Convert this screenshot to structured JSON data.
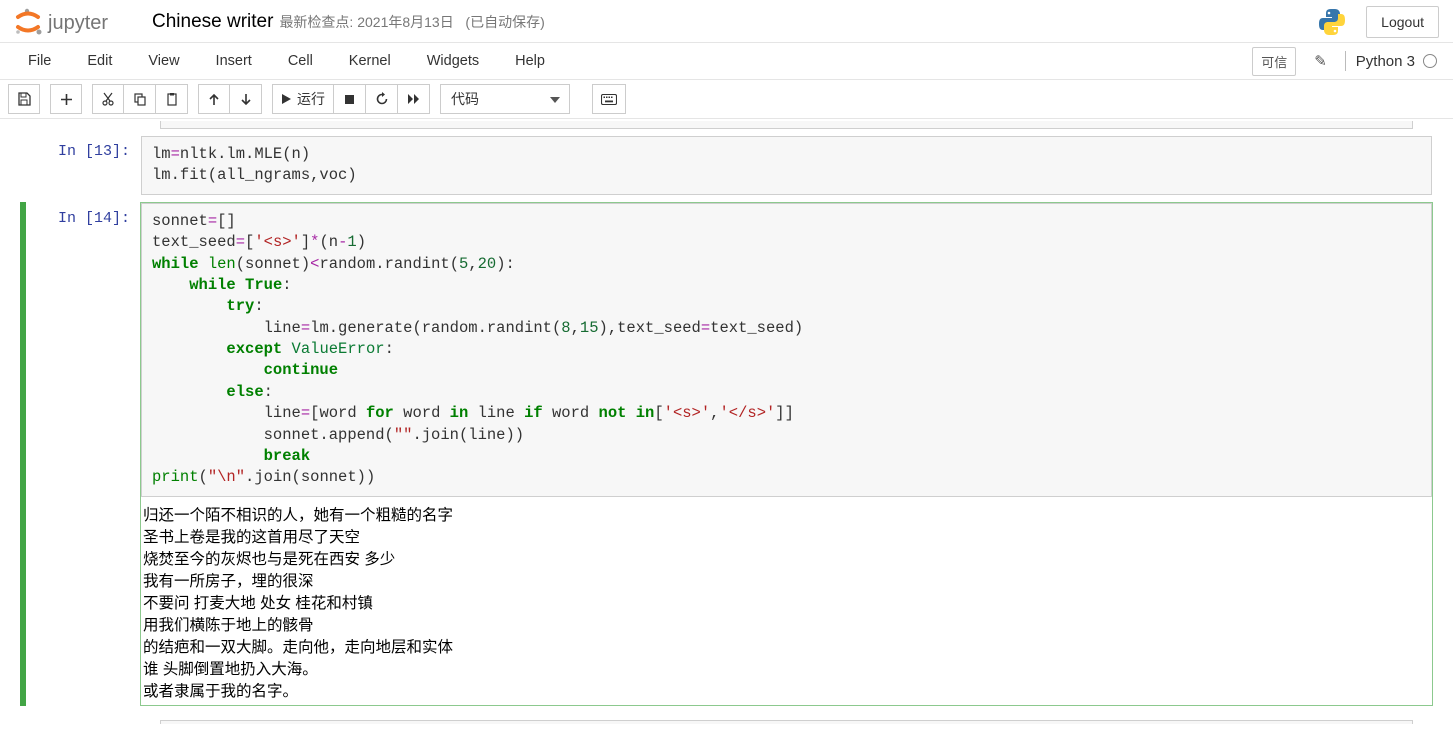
{
  "header": {
    "logo_text": "jupyter",
    "notebook_title": "Chinese writer",
    "checkpoint_label": "最新检查点: 2021年8月13日",
    "autosave_label": "(已自动保存)",
    "logout": "Logout"
  },
  "menu": {
    "file": "File",
    "edit": "Edit",
    "view": "View",
    "insert": "Insert",
    "cell": "Cell",
    "kernel": "Kernel",
    "widgets": "Widgets",
    "help": "Help",
    "trusted": "可信",
    "kernel_name": "Python 3"
  },
  "toolbar": {
    "run_label": "运行",
    "cell_type": "代码"
  },
  "cells": {
    "cell13": {
      "prompt": "In [13]:",
      "line1_a": "lm",
      "line1_b": "=nltk.lm.MLE(n)",
      "line2": "lm.fit(all_ngrams,voc)"
    },
    "cell14": {
      "prompt": "In [14]:",
      "output": "归还一个陌不相识的人，她有一个粗糙的名字\n圣书上卷是我的这首用尽了天空\n烧焚至今的灰烬也与是死在西安 多少\n我有一所房子，埋的很深\n不要问 打麦大地 处女 桂花和村镇\n用我们横陈于地上的骸骨\n的结疤和一双大脚。走向他，走向地层和实体\n谁 头脚倒置地扔入大海。\n或者隶属于我的名字。"
    }
  }
}
